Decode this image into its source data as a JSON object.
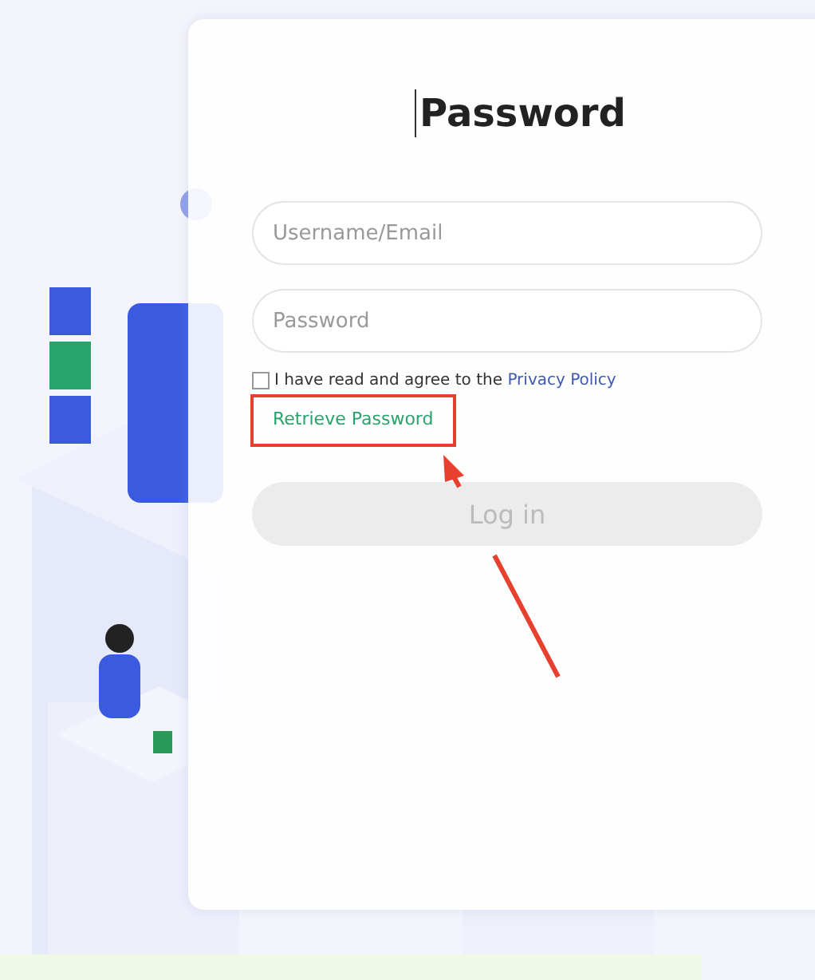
{
  "title": "Password",
  "username": {
    "placeholder": "Username/Email"
  },
  "password": {
    "placeholder": "Password"
  },
  "agreement": {
    "checked": false,
    "text": "I have read and agree to the",
    "link": "Privacy Policy"
  },
  "retrieve_link": {
    "label": "Retrieve Password",
    "highlighted": true
  },
  "login_button": {
    "label": "Log in",
    "disabled": true
  }
}
